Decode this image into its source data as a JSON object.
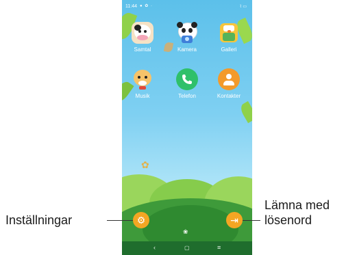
{
  "status_bar": {
    "time": "11:44",
    "indicators": "● ✿ ·",
    "right": "⌇ ▭"
  },
  "apps": [
    {
      "label": "Samtal",
      "icon": "cow-icon"
    },
    {
      "label": "Kamera",
      "icon": "panda-camera-icon"
    },
    {
      "label": "Galleri",
      "icon": "chick-gallery-icon"
    },
    {
      "label": "Musik",
      "icon": "cat-music-icon"
    },
    {
      "label": "Telefon",
      "icon": "phone-icon"
    },
    {
      "label": "Kontakter",
      "icon": "contacts-icon"
    }
  ],
  "callouts": {
    "settings": "Inställningar",
    "exit_line1": "Lämna med",
    "exit_line2": "lösenord"
  },
  "nav": {
    "back": "‹",
    "home": "▢",
    "recents": "≡"
  },
  "bottom_buttons": {
    "settings_glyph": "⚙",
    "exit_glyph": "⇥",
    "paw_glyph": "❀"
  },
  "colors": {
    "sky": "#6cc8ee",
    "grass": "#3e9a3a",
    "accent": "#f3a623",
    "phone_green": "#2fc06a",
    "contacts_orange": "#f39a2b"
  }
}
